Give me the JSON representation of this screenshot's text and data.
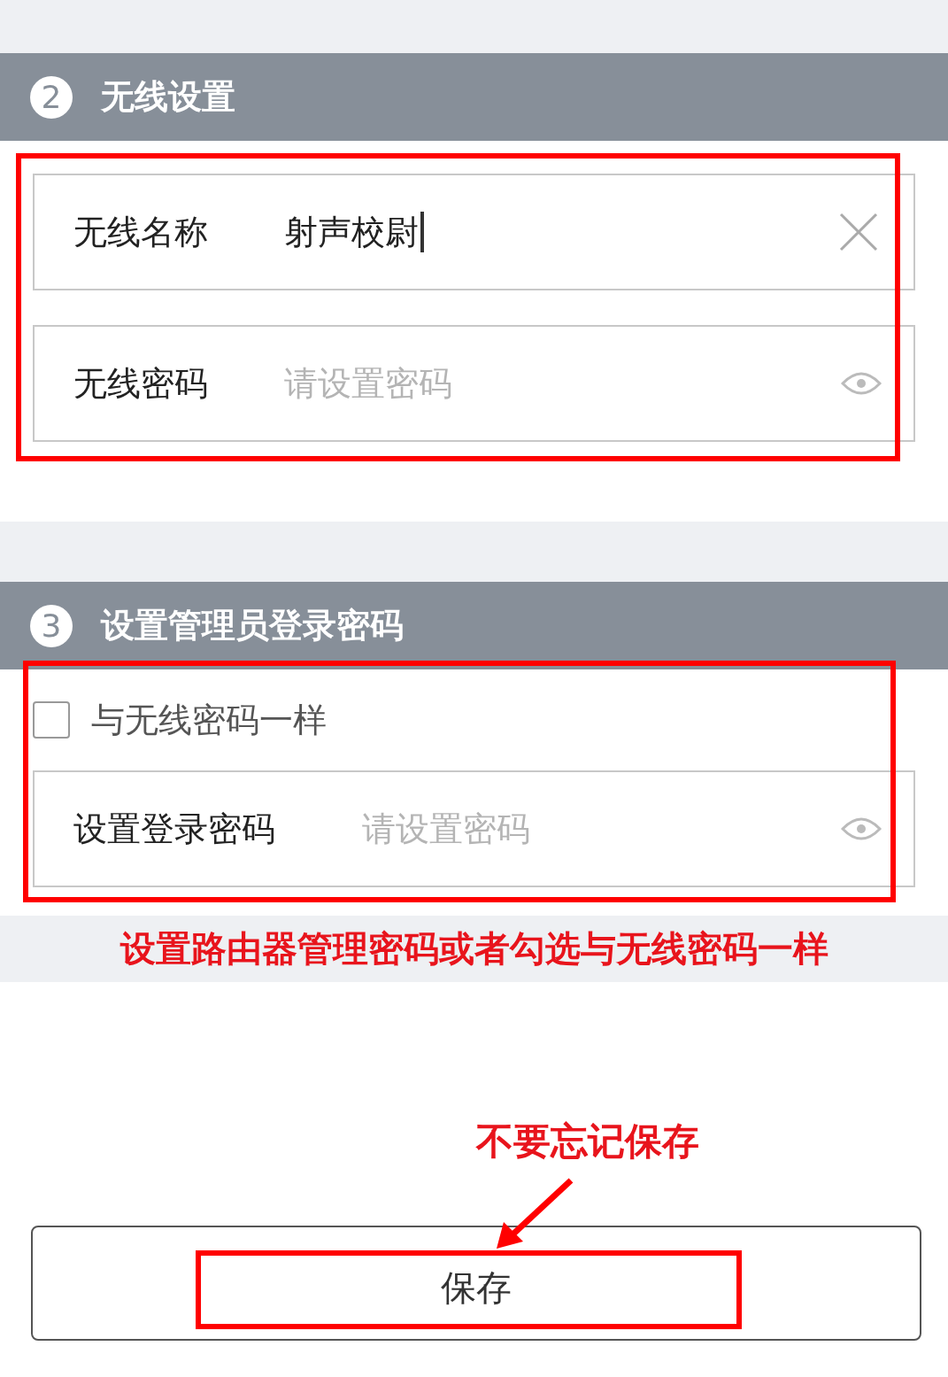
{
  "wireless": {
    "number": "2",
    "title": "无线设置",
    "fields": [
      {
        "kind": "text",
        "label": "无线名称",
        "value": "射声校尉"
      },
      {
        "kind": "password",
        "label": "无线密码",
        "placeholder": "请设置密码"
      }
    ]
  },
  "admin": {
    "number": "3",
    "title": "设置管理员登录密码",
    "same_as_wireless": {
      "label": "与无线密码一样",
      "checked": false
    },
    "field": {
      "kind": "password",
      "label": "设置登录密码",
      "placeholder": "请设置密码"
    }
  },
  "annotations": [
    "设置路由器管理密码或者勾选与无线密码一样",
    "不要忘记保存"
  ],
  "save_button": "保存"
}
